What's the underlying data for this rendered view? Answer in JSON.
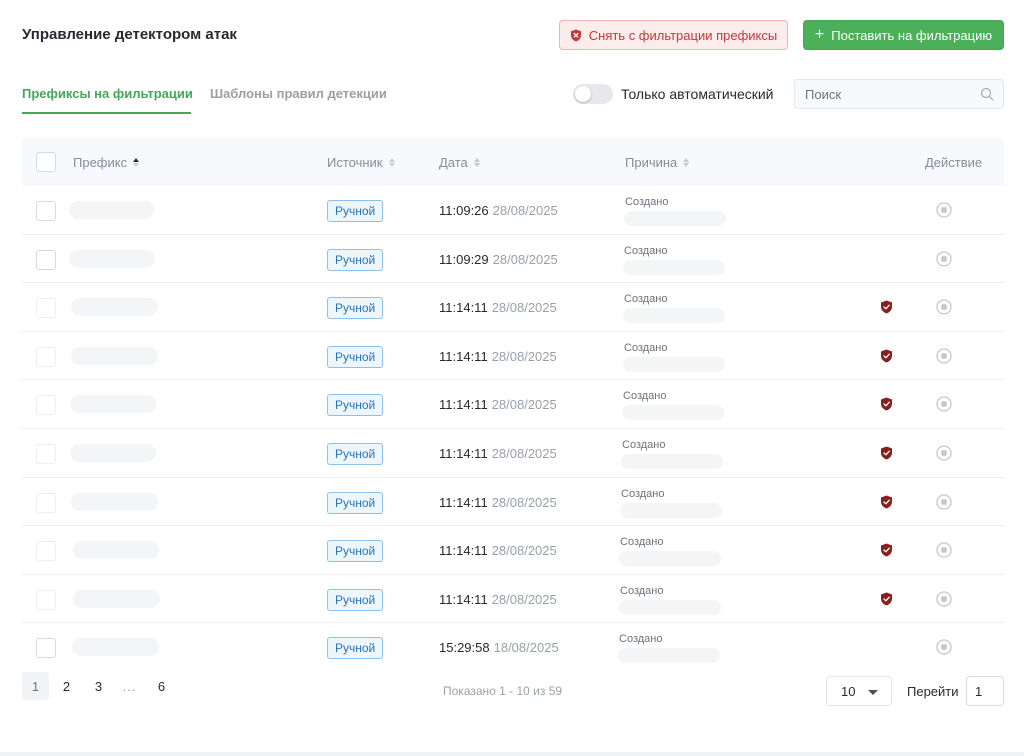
{
  "header": {
    "title": "Управление детектором атак",
    "remove_button": "Снять с фильтрации префиксы",
    "add_button": "Поставить на фильтрацию"
  },
  "tabs": [
    {
      "label": "Префиксы на фильтрации",
      "active": true
    },
    {
      "label": "Шаблоны правил детекции",
      "active": false
    }
  ],
  "filters": {
    "auto_only_label": "Только автоматический",
    "auto_only_enabled": false,
    "search_placeholder": "Поиск",
    "search_value": ""
  },
  "table": {
    "columns": {
      "prefix": "Префикс",
      "source": "Источник",
      "date": "Дата",
      "reason": "Причина",
      "action": "Действие"
    },
    "rows": [
      {
        "source": "Ручной",
        "time": "11:09:26",
        "date": "28/08/2025",
        "reason": "Создано",
        "shield": false
      },
      {
        "source": "Ручной",
        "time": "11:09:29",
        "date": "28/08/2025",
        "reason": "Создано",
        "shield": false
      },
      {
        "source": "Ручной",
        "time": "11:14:11",
        "date": "28/08/2025",
        "reason": "Создано",
        "shield": true
      },
      {
        "source": "Ручной",
        "time": "11:14:11",
        "date": "28/08/2025",
        "reason": "Создано",
        "shield": true
      },
      {
        "source": "Ручной",
        "time": "11:14:11",
        "date": "28/08/2025",
        "reason": "Создано",
        "shield": true
      },
      {
        "source": "Ручной",
        "time": "11:14:11",
        "date": "28/08/2025",
        "reason": "Создано",
        "shield": true
      },
      {
        "source": "Ручной",
        "time": "11:14:11",
        "date": "28/08/2025",
        "reason": "Создано",
        "shield": true
      },
      {
        "source": "Ручной",
        "time": "11:14:11",
        "date": "28/08/2025",
        "reason": "Создано",
        "shield": true
      },
      {
        "source": "Ручной",
        "time": "11:14:11",
        "date": "28/08/2025",
        "reason": "Создано",
        "shield": true
      },
      {
        "source": "Ручной",
        "time": "15:29:58",
        "date": "18/08/2025",
        "reason": "Создано",
        "shield": false
      }
    ]
  },
  "pagination": {
    "pages": [
      "1",
      "2",
      "3",
      "...",
      "6"
    ],
    "current": "1",
    "summary": "Показано 1 - 10 из 59",
    "page_size": "10",
    "goto_label": "Перейти",
    "goto_value": "1"
  },
  "colors": {
    "accent": "#47a65a",
    "danger": "#c23a3a",
    "shield": "#8a1f1f",
    "badge": "#2a73b8"
  },
  "icons": {
    "remove_button": "shield-x-icon",
    "add_button": "plus-icon",
    "search": "search-icon",
    "row_shield": "shield-check-icon",
    "row_action": "stop-circle-icon",
    "sort": "sort-arrows-icon"
  }
}
